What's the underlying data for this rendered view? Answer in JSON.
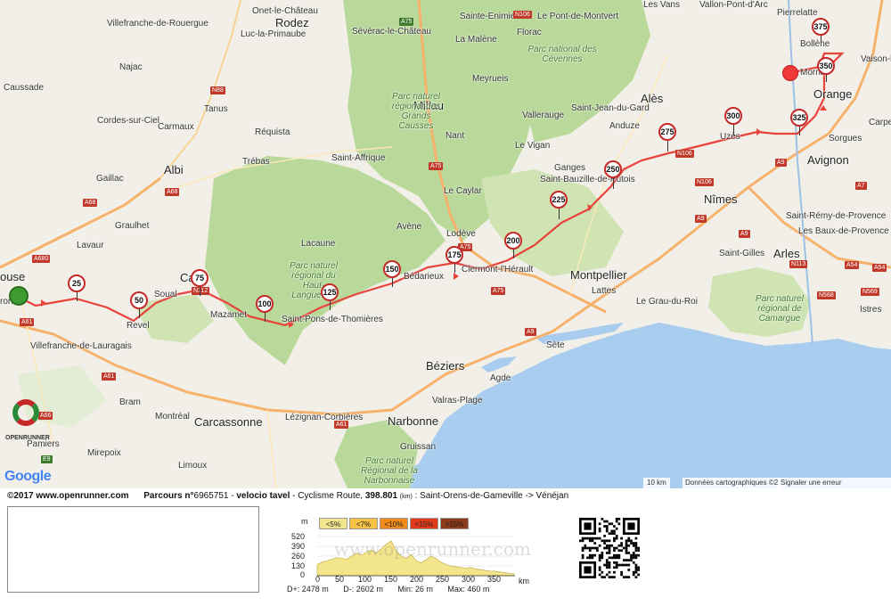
{
  "map": {
    "cities": [
      {
        "id": "toulouse",
        "label": "ouse"
      },
      {
        "id": "albi",
        "label": "Albi"
      },
      {
        "id": "castres",
        "label": "Ca"
      },
      {
        "id": "mazamet",
        "label": "Mazamet"
      },
      {
        "id": "montpellier",
        "label": "Montpellier"
      },
      {
        "id": "nimes",
        "label": "Nîmes"
      },
      {
        "id": "avignon",
        "label": "Avignon"
      },
      {
        "id": "orange",
        "label": "Orange"
      },
      {
        "id": "beziers",
        "label": "Béziers"
      },
      {
        "id": "narbonne",
        "label": "Narbonne"
      },
      {
        "id": "carcassonne",
        "label": "Carcassonne"
      },
      {
        "id": "arles",
        "label": "Arles"
      },
      {
        "id": "sete",
        "label": "Sète"
      },
      {
        "id": "ales",
        "label": "Alès"
      },
      {
        "id": "rodez",
        "label": "Rodez"
      },
      {
        "id": "millau",
        "label": "Millau"
      }
    ],
    "towns": [
      "Onet-le-Château",
      "Villefranche-de-Rouergue",
      "Luc-la-Primaube",
      "Sévérac-le-Château",
      "Sainte-Enimie",
      "Le Pont-de-Montvert",
      "Les Vans",
      "Vallon-Pont-d'Arc",
      "Pierrelatte",
      "Bollène",
      "Vaison-la-Ro",
      "Mornas",
      "Caussade",
      "Najac",
      "Tanus",
      "Carmaux",
      "Cordes-sur-Ciel",
      "Gaillac",
      "Graulhet",
      "Lavaur",
      "Réquista",
      "Trébas",
      "Saint-Affrique",
      "Nant",
      "Meyrueis",
      "Florac",
      "La Malène",
      "Saint-Jean-du-Gard",
      "Vallerauge",
      "Anduze",
      "Le Vigan",
      "Ganges",
      "Saint-Bauzille-de-Putois",
      "Uzès",
      "Sorgues",
      "Carpe",
      "Le Caylar",
      "Lodève",
      "Avène",
      "Lacaune",
      "Bédarieux",
      "Clermont-l'Hérault",
      "Lattes",
      "Le Grau-du-Roi",
      "Saint-Gilles",
      "Saint-Rémy-de-Provence",
      "Les Baux-de-Provence",
      "Istres",
      "Agde",
      "Valras-Plage",
      "Gruissan",
      "Lézignan-Corbières",
      "Bram",
      "Montréal",
      "Revel",
      "Soual",
      "Villefranche-de-Lauragais",
      "Saint-Pons-de-Thomières",
      "Mirepoix",
      "Limoux",
      "Pamiers",
      "ronne"
    ],
    "parks": [
      "Parc naturel régional des Grands Causses",
      "Parc national des Cévennes",
      "Parc naturel régional du Haut-Languedoc",
      "Parc naturel régional de Camargue",
      "Parc naturel Régional de la Narbonnaise"
    ],
    "roads": [
      "A75",
      "A75",
      "A75",
      "N88",
      "A68",
      "A68",
      "A680",
      "A61",
      "A61",
      "A61",
      "A9",
      "A9",
      "A9",
      "A9",
      "N106",
      "N106",
      "N106",
      "A7",
      "A54",
      "A54",
      "N113",
      "N568",
      "N569",
      "A66",
      "E9",
      "N112",
      "A75"
    ],
    "km_markers": [
      "25",
      "50",
      "75",
      "100",
      "125",
      "150",
      "175",
      "200",
      "225",
      "250",
      "275",
      "300",
      "325",
      "350",
      "375"
    ],
    "route_color": "#e8433b",
    "start_color": "#3e9b2f",
    "end_color": "#f03a3a",
    "google_logo": "Google",
    "openrunner_logo": "OPENRUNNER",
    "scale": "10 km",
    "credit": "Données cartographiques ©2",
    "report_error": "Signaler une erreur cartographique"
  },
  "info": {
    "copyright": "©2017 www.openrunner.com",
    "parcours_label": "Parcours n°",
    "parcours_id": "6965751",
    "title": "velocio tavel",
    "activity": "Cyclisme Route,",
    "distance": "398.801",
    "distance_unit": "(km)",
    "route": ": Saint-Orens-de-Gameville -> Vénéjan"
  },
  "profile": {
    "unit_y": "m",
    "unit_x": "km",
    "legend": [
      {
        "label": "<5%",
        "color": "#f3e58c"
      },
      {
        "label": "<7%",
        "color": "#f5c243"
      },
      {
        "label": "<10%",
        "color": "#f08a1b"
      },
      {
        "label": "<15%",
        "color": "#e33a1c"
      },
      {
        "label": ">15%",
        "color": "#8b3a1a"
      }
    ],
    "y_ticks": [
      "520",
      "390",
      "260",
      "130",
      "0"
    ],
    "x_ticks": [
      "0",
      "50",
      "100",
      "150",
      "200",
      "250",
      "300",
      "350"
    ],
    "watermark": "www.openrunner.com",
    "stats": {
      "d_plus": "D+: 2478 m",
      "d_minus": "D-: 2602 m",
      "min": "Min: 26 m",
      "max": "Max: 460 m"
    },
    "chart_data": {
      "type": "area",
      "x": [
        0,
        10,
        20,
        30,
        40,
        50,
        60,
        70,
        80,
        90,
        100,
        110,
        120,
        130,
        140,
        150,
        160,
        170,
        180,
        190,
        200,
        210,
        220,
        230,
        240,
        250,
        260,
        270,
        280,
        290,
        300,
        310,
        320,
        330,
        340,
        350,
        360,
        370,
        380,
        390,
        398
      ],
      "values": [
        150,
        180,
        200,
        220,
        240,
        230,
        220,
        260,
        300,
        270,
        320,
        340,
        300,
        360,
        420,
        460,
        330,
        260,
        230,
        280,
        200,
        170,
        210,
        260,
        230,
        180,
        150,
        130,
        120,
        110,
        100,
        110,
        90,
        80,
        70,
        60,
        60,
        50,
        40,
        30,
        26
      ],
      "xlabel": "km",
      "ylabel": "m",
      "xlim": [
        0,
        400
      ],
      "ylim": [
        0,
        520
      ]
    }
  }
}
